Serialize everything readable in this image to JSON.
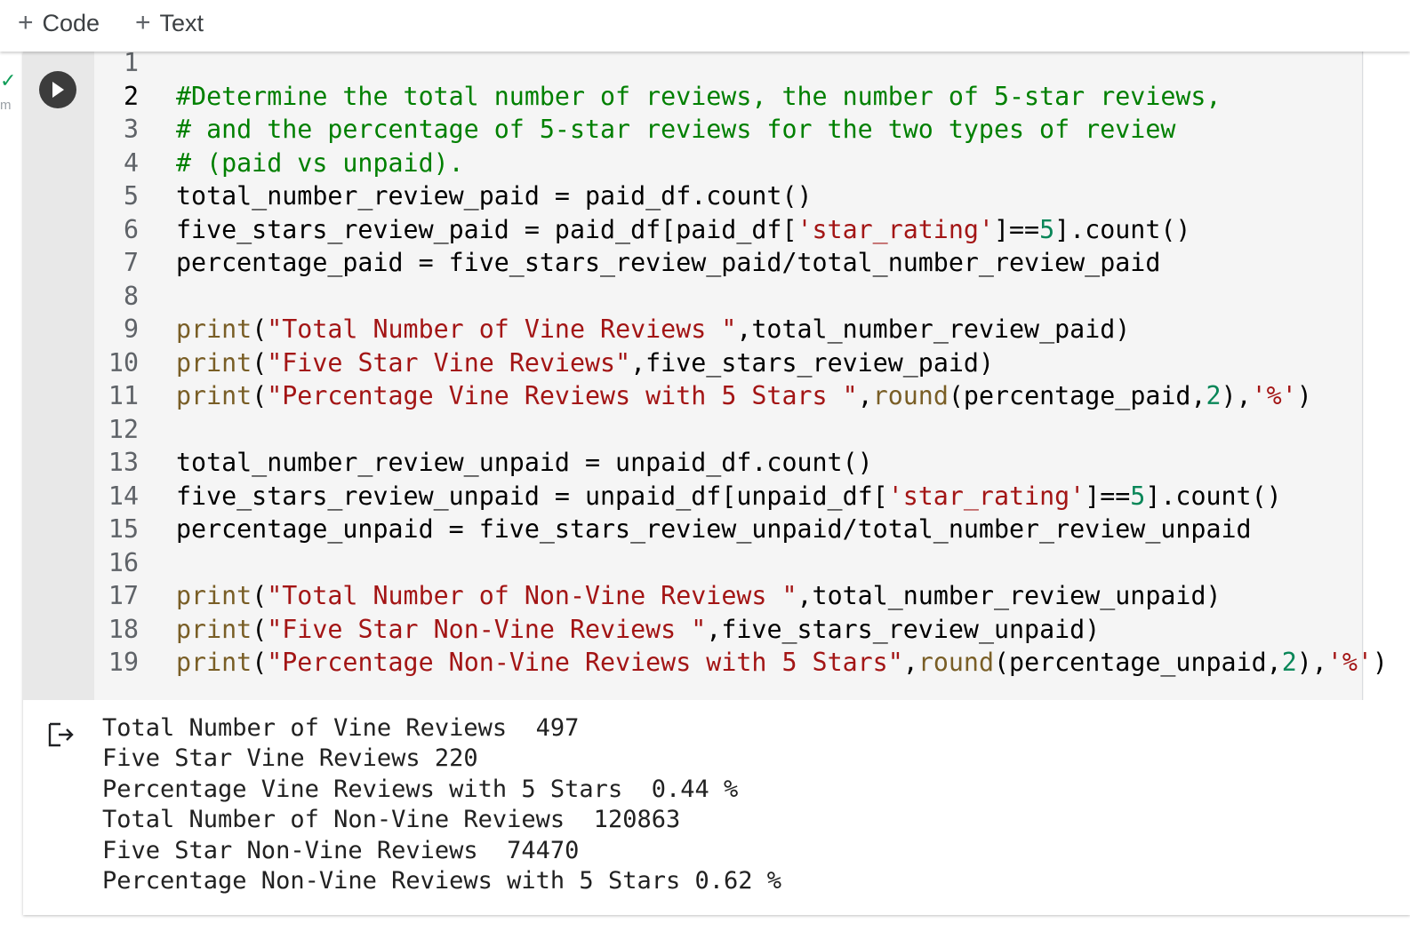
{
  "toolbar": {
    "add_code_label": "Code",
    "add_text_label": "Text",
    "plus_glyph": "+"
  },
  "cell": {
    "execution_status": "✓",
    "execution_time": "m",
    "code_lines": [
      {
        "n": "1",
        "tokens": []
      },
      {
        "n": "2",
        "tokens": [
          {
            "t": "cm",
            "v": "#Determine the total number of reviews, the number of 5-star reviews,"
          }
        ]
      },
      {
        "n": "3",
        "tokens": [
          {
            "t": "cm",
            "v": "# and the percentage of 5-star reviews for the two types of review"
          }
        ]
      },
      {
        "n": "4",
        "tokens": [
          {
            "t": "cm",
            "v": "# (paid vs unpaid)."
          }
        ]
      },
      {
        "n": "5",
        "tokens": [
          {
            "t": "",
            "v": "total_number_review_paid = paid_df.count()"
          }
        ]
      },
      {
        "n": "6",
        "tokens": [
          {
            "t": "",
            "v": "five_stars_review_paid = paid_df[paid_df["
          },
          {
            "t": "st",
            "v": "'star_rating'"
          },
          {
            "t": "",
            "v": "]=="
          },
          {
            "t": "nm",
            "v": "5"
          },
          {
            "t": "",
            "v": "].count()"
          }
        ]
      },
      {
        "n": "7",
        "tokens": [
          {
            "t": "",
            "v": "percentage_paid = five_stars_review_paid/total_number_review_paid"
          }
        ]
      },
      {
        "n": "8",
        "tokens": []
      },
      {
        "n": "9",
        "tokens": [
          {
            "t": "kw",
            "v": "print"
          },
          {
            "t": "",
            "v": "("
          },
          {
            "t": "st",
            "v": "\"Total Number of Vine Reviews \""
          },
          {
            "t": "",
            "v": ",total_number_review_paid)"
          }
        ]
      },
      {
        "n": "10",
        "tokens": [
          {
            "t": "kw",
            "v": "print"
          },
          {
            "t": "",
            "v": "("
          },
          {
            "t": "st",
            "v": "\"Five Star Vine Reviews\""
          },
          {
            "t": "",
            "v": ",five_stars_review_paid)"
          }
        ]
      },
      {
        "n": "11",
        "tokens": [
          {
            "t": "kw",
            "v": "print"
          },
          {
            "t": "",
            "v": "("
          },
          {
            "t": "st",
            "v": "\"Percentage Vine Reviews with 5 Stars \""
          },
          {
            "t": "",
            "v": ","
          },
          {
            "t": "kw",
            "v": "round"
          },
          {
            "t": "",
            "v": "(percentage_paid,"
          },
          {
            "t": "nm",
            "v": "2"
          },
          {
            "t": "",
            "v": "),"
          },
          {
            "t": "st",
            "v": "'%'"
          },
          {
            "t": "",
            "v": ")"
          }
        ]
      },
      {
        "n": "12",
        "tokens": []
      },
      {
        "n": "13",
        "tokens": [
          {
            "t": "",
            "v": "total_number_review_unpaid = unpaid_df.count()"
          }
        ]
      },
      {
        "n": "14",
        "tokens": [
          {
            "t": "",
            "v": "five_stars_review_unpaid = unpaid_df[unpaid_df["
          },
          {
            "t": "st",
            "v": "'star_rating'"
          },
          {
            "t": "",
            "v": "]=="
          },
          {
            "t": "nm",
            "v": "5"
          },
          {
            "t": "",
            "v": "].count()"
          }
        ]
      },
      {
        "n": "15",
        "tokens": [
          {
            "t": "",
            "v": "percentage_unpaid = five_stars_review_unpaid/total_number_review_unpaid"
          }
        ]
      },
      {
        "n": "16",
        "tokens": []
      },
      {
        "n": "17",
        "tokens": [
          {
            "t": "kw",
            "v": "print"
          },
          {
            "t": "",
            "v": "("
          },
          {
            "t": "st",
            "v": "\"Total Number of Non-Vine Reviews \""
          },
          {
            "t": "",
            "v": ",total_number_review_unpaid)"
          }
        ]
      },
      {
        "n": "18",
        "tokens": [
          {
            "t": "kw",
            "v": "print"
          },
          {
            "t": "",
            "v": "("
          },
          {
            "t": "st",
            "v": "\"Five Star Non-Vine Reviews \""
          },
          {
            "t": "",
            "v": ",five_stars_review_unpaid)"
          }
        ]
      },
      {
        "n": "19",
        "tokens": [
          {
            "t": "kw",
            "v": "print"
          },
          {
            "t": "",
            "v": "("
          },
          {
            "t": "st",
            "v": "\"Percentage Non-Vine Reviews with 5 Stars\""
          },
          {
            "t": "",
            "v": ","
          },
          {
            "t": "kw",
            "v": "round"
          },
          {
            "t": "",
            "v": "(percentage_unpaid,"
          },
          {
            "t": "nm",
            "v": "2"
          },
          {
            "t": "",
            "v": "),"
          },
          {
            "t": "st",
            "v": "'%'"
          },
          {
            "t": "",
            "v": ")"
          }
        ]
      }
    ],
    "active_line": "2"
  },
  "output": {
    "lines": [
      "Total Number of Vine Reviews  497",
      "Five Star Vine Reviews 220",
      "Percentage Vine Reviews with 5 Stars  0.44 %",
      "Total Number of Non-Vine Reviews  120863",
      "Five Star Non-Vine Reviews  74470",
      "Percentage Non-Vine Reviews with 5 Stars 0.62 %"
    ]
  },
  "colors": {
    "comment": "#008000",
    "string": "#a31515",
    "builtin": "#795e26",
    "number": "#098658",
    "check": "#0f9d58"
  },
  "icons": {
    "run": "play-icon",
    "output": "output-arrow-icon"
  }
}
